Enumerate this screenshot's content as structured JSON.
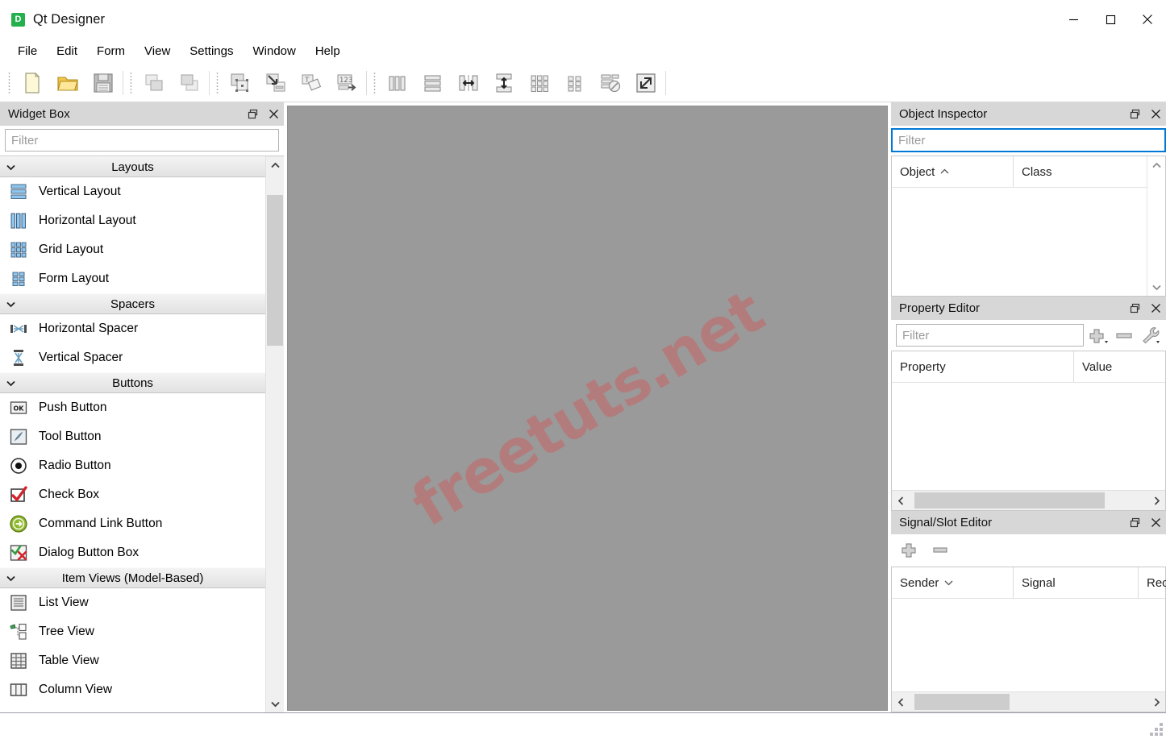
{
  "window": {
    "title": "Qt Designer",
    "icon": "qt-designer-icon",
    "icon_letter": "D",
    "minimize_label": "Minimize",
    "maximize_label": "Maximize",
    "close_label": "Close"
  },
  "menubar": {
    "items": [
      {
        "label": "File"
      },
      {
        "label": "Edit"
      },
      {
        "label": "Form"
      },
      {
        "label": "View"
      },
      {
        "label": "Settings"
      },
      {
        "label": "Window"
      },
      {
        "label": "Help"
      }
    ]
  },
  "toolbar": {
    "groups": [
      {
        "name": "file-group",
        "buttons": [
          {
            "name": "new-form-button",
            "icon": "new-file-icon",
            "label": "New"
          },
          {
            "name": "open-form-button",
            "icon": "open-folder-icon",
            "label": "Open"
          },
          {
            "name": "save-form-button",
            "icon": "save-disk-icon",
            "label": "Save"
          }
        ]
      },
      {
        "name": "edit-group",
        "buttons": [
          {
            "name": "undo-button",
            "icon": "undo-icon",
            "label": "Undo"
          },
          {
            "name": "redo-button",
            "icon": "redo-icon",
            "label": "Redo"
          }
        ]
      },
      {
        "name": "mode-group",
        "buttons": [
          {
            "name": "edit-widgets-button",
            "icon": "edit-widgets-icon",
            "label": "Edit Widgets"
          },
          {
            "name": "edit-signals-slots-button",
            "icon": "edit-signals-slots-icon",
            "label": "Edit Signals/Slots"
          },
          {
            "name": "edit-buddies-button",
            "icon": "edit-buddies-icon",
            "label": "Edit Buddies"
          },
          {
            "name": "edit-tab-order-button",
            "icon": "edit-tab-order-icon",
            "label": "Edit Tab Order"
          }
        ]
      },
      {
        "name": "layout-group",
        "buttons": [
          {
            "name": "layout-horizontally-button",
            "icon": "layout-horizontal-icon",
            "label": "Lay Out Horizontally"
          },
          {
            "name": "layout-vertically-button",
            "icon": "layout-vertical-icon",
            "label": "Lay Out Vertically"
          },
          {
            "name": "layout-splitter-horizontal-button",
            "icon": "splitter-horizontal-icon",
            "label": "Lay Out Horizontally in Splitter"
          },
          {
            "name": "layout-splitter-vertical-button",
            "icon": "splitter-vertical-icon",
            "label": "Lay Out Vertically in Splitter"
          },
          {
            "name": "layout-grid-button",
            "icon": "layout-grid-icon",
            "label": "Lay Out in a Grid"
          },
          {
            "name": "layout-form-button",
            "icon": "layout-form-icon",
            "label": "Lay Out in a Form Layout"
          },
          {
            "name": "break-layout-button",
            "icon": "break-layout-icon",
            "label": "Break Layout"
          },
          {
            "name": "adjust-size-button",
            "icon": "adjust-size-icon",
            "label": "Adjust Size"
          }
        ]
      }
    ]
  },
  "widget_box": {
    "title": "Widget Box",
    "float_label": "Float",
    "close_label": "Close",
    "filter_placeholder": "Filter",
    "filter_value": "",
    "scrollbar": {
      "thumb_top_pct": 4,
      "thumb_height_pct": 29
    },
    "sections": [
      {
        "title": "Layouts",
        "expanded": true,
        "items": [
          {
            "label": "Vertical Layout",
            "icon": "vertical-layout-icon"
          },
          {
            "label": "Horizontal Layout",
            "icon": "horizontal-layout-icon"
          },
          {
            "label": "Grid Layout",
            "icon": "grid-layout-icon"
          },
          {
            "label": "Form Layout",
            "icon": "form-layout-icon"
          }
        ]
      },
      {
        "title": "Spacers",
        "expanded": true,
        "items": [
          {
            "label": "Horizontal Spacer",
            "icon": "horizontal-spacer-icon"
          },
          {
            "label": "Vertical Spacer",
            "icon": "vertical-spacer-icon"
          }
        ]
      },
      {
        "title": "Buttons",
        "expanded": true,
        "items": [
          {
            "label": "Push Button",
            "icon": "push-button-icon"
          },
          {
            "label": "Tool Button",
            "icon": "tool-button-icon"
          },
          {
            "label": "Radio Button",
            "icon": "radio-button-icon"
          },
          {
            "label": "Check Box",
            "icon": "check-box-icon"
          },
          {
            "label": "Command Link Button",
            "icon": "command-link-button-icon"
          },
          {
            "label": "Dialog Button Box",
            "icon": "dialog-button-box-icon"
          }
        ]
      },
      {
        "title": "Item Views (Model-Based)",
        "expanded": true,
        "items": [
          {
            "label": "List View",
            "icon": "list-view-icon"
          },
          {
            "label": "Tree View",
            "icon": "tree-view-icon"
          },
          {
            "label": "Table View",
            "icon": "table-view-icon"
          },
          {
            "label": "Column View",
            "icon": "column-view-icon"
          }
        ]
      }
    ]
  },
  "form_canvas": {
    "name": "form-canvas",
    "background_color": "#9a9a9a",
    "watermark_text": "freetuts.net",
    "watermark_color": "#c36b6b"
  },
  "object_inspector": {
    "title": "Object Inspector",
    "float_label": "Float",
    "close_label": "Close",
    "filter_placeholder": "Filter",
    "filter_value": "",
    "filter_focused": true,
    "columns": [
      {
        "label": "Object",
        "sort": "asc"
      },
      {
        "label": "Class",
        "sort": "none"
      }
    ],
    "rows": []
  },
  "property_editor": {
    "title": "Property Editor",
    "float_label": "Float",
    "close_label": "Close",
    "filter_placeholder": "Filter",
    "filter_value": "",
    "tools": [
      {
        "name": "add-property-button",
        "icon": "plus-icon",
        "label": "Add Dynamic Property",
        "has_dropdown": true
      },
      {
        "name": "remove-property-button",
        "icon": "minus-icon",
        "label": "Remove Dynamic Property",
        "has_dropdown": false
      },
      {
        "name": "configure-property-editor-button",
        "icon": "wrench-icon",
        "label": "Configure Property Editor",
        "has_dropdown": true
      }
    ],
    "columns": [
      {
        "label": "Property",
        "sort": "none"
      },
      {
        "label": "Value",
        "sort": "none"
      }
    ],
    "rows": [],
    "hscroll": {
      "thumb_left_pct": 2,
      "thumb_width_pct": 80
    }
  },
  "signal_slot_editor": {
    "title": "Signal/Slot Editor",
    "float_label": "Float",
    "close_label": "Close",
    "tools": [
      {
        "name": "add-connection-button",
        "icon": "plus-icon",
        "label": "Add"
      },
      {
        "name": "remove-connection-button",
        "icon": "minus-icon",
        "label": "Remove"
      }
    ],
    "columns": [
      {
        "label": "Sender",
        "sort": "desc"
      },
      {
        "label": "Signal",
        "sort": "none"
      },
      {
        "label": "Rec",
        "sort": "none"
      }
    ],
    "rows": [],
    "hscroll": {
      "thumb_left_pct": 2,
      "thumb_width_pct": 40
    }
  },
  "statusbar": {
    "text": "",
    "resize_grip": "resize-grip-icon"
  }
}
